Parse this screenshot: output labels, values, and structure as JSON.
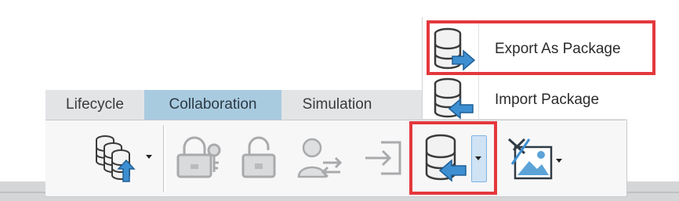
{
  "ribbon": {
    "tabs": [
      {
        "label": "Lifecycle",
        "active": false
      },
      {
        "label": "Collaboration",
        "active": true
      },
      {
        "label": "Simulation",
        "active": false
      }
    ]
  },
  "menu": {
    "items": [
      {
        "label": "Export As Package",
        "icon": "database-export-icon",
        "highlighted": true
      },
      {
        "label": "Import Package",
        "icon": "database-import-icon",
        "highlighted": false
      }
    ]
  },
  "colors": {
    "highlight_red": "#e4383d",
    "active_tab": "#a9cbe0",
    "arrow_blue": "#3d8fd1",
    "dropdown_blue": "#cfe3f5"
  }
}
